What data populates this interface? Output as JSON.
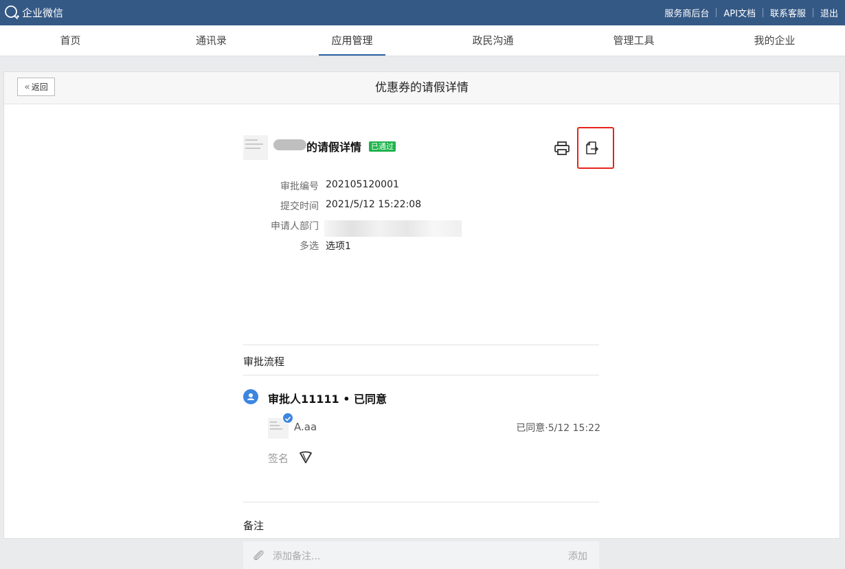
{
  "topbar": {
    "brand": "企业微信",
    "links": [
      "服务商后台",
      "API文档",
      "联系客服",
      "退出"
    ]
  },
  "nav": {
    "tabs": [
      "首页",
      "通讯录",
      "应用管理",
      "政民沟通",
      "管理工具",
      "我的企业"
    ],
    "active": "应用管理"
  },
  "page": {
    "back_label": "返回",
    "title": "优惠券的请假详情"
  },
  "detail": {
    "title": "的请假详情",
    "status": "已通过",
    "fields": [
      {
        "label": "审批编号",
        "value": "202105120001"
      },
      {
        "label": "提交时间",
        "value": "2021/5/12 15:22:08"
      },
      {
        "label": "申请人部门",
        "value": ""
      },
      {
        "label": "多选",
        "value": "选项1"
      }
    ]
  },
  "flow": {
    "section_title": "审批流程",
    "approver_line": "审批人11111 • 已同意",
    "approver_name": "A.aa",
    "approve_time": "已同意·5/12 15:22",
    "sign_label": "签名"
  },
  "note": {
    "section_title": "备注",
    "placeholder": "添加备注...",
    "add_label": "添加"
  },
  "colors": {
    "topbar": "#355985",
    "status_green": "#1fb34c",
    "highlight_red": "#e5231b",
    "accent_blue": "#3c86e0"
  }
}
